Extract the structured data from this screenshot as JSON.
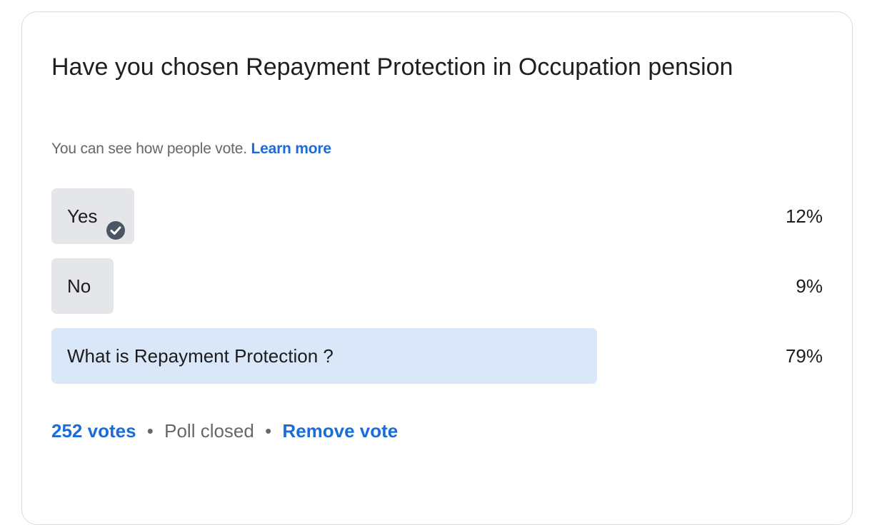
{
  "poll": {
    "question": "Have you chosen Repayment Protection in Occupation pension",
    "visibility_note": "You can see how people vote.",
    "learn_more_label": "Learn more",
    "options": [
      {
        "label": "Yes",
        "percent_label": "12%",
        "share": 0.12,
        "selected_by_user": true,
        "icon": "check-circle-icon"
      },
      {
        "label": "No",
        "percent_label": "9%",
        "share": 0.09,
        "selected_by_user": false
      },
      {
        "label": "What is Repayment Protection ?",
        "percent_label": "79%",
        "share": 0.79,
        "selected_by_user": false,
        "leading": true
      }
    ],
    "footer": {
      "votes_label": "252 votes",
      "separator": "•",
      "status_label": "Poll closed",
      "remove_vote_label": "Remove vote"
    }
  },
  "colors": {
    "link": "#1a6dd8",
    "option_fill": "#e4e6e9",
    "leading_option_fill": "#dae7f8",
    "check_icon": "#4b5563"
  }
}
